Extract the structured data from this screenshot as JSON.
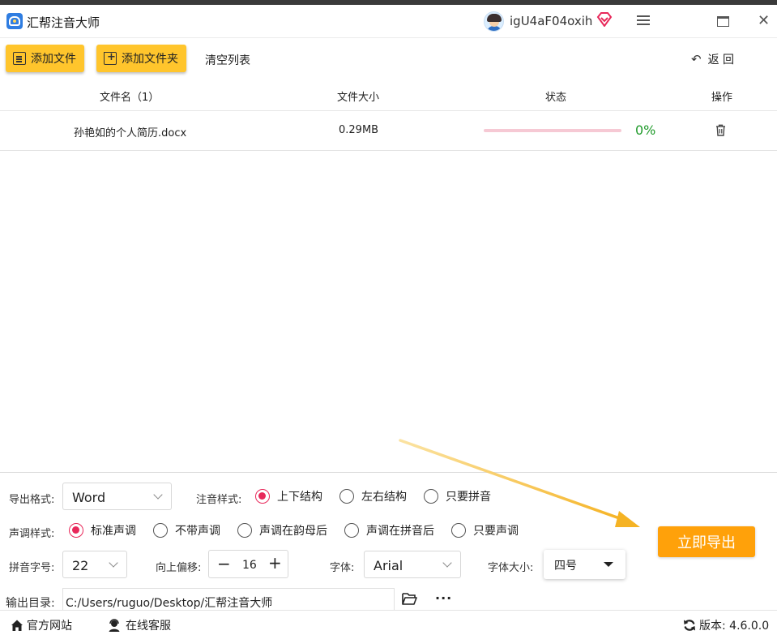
{
  "window": {
    "title": "汇帮注音大师",
    "username": "igU4aF04oxih",
    "icons": [
      "app-logo-icon",
      "avatar",
      "vip-diamond-icon",
      "menu-icon",
      "maximize-icon",
      "close-icon"
    ]
  },
  "toolbar": {
    "add_file_label": "添加文件",
    "add_folder_label": "添加文件夹",
    "clear_list_label": "清空列表",
    "back_label": "返 回"
  },
  "table": {
    "headers": {
      "name": "文件名（1）",
      "size": "文件大小",
      "status": "状态",
      "operation": "操作"
    },
    "rows": [
      {
        "name": "孙艳如的个人简历.docx",
        "size": "0.29MB",
        "progress": 0,
        "percent": "0%"
      }
    ]
  },
  "settings": {
    "export_format": {
      "label": "导出格式:",
      "value": "Word"
    },
    "annotation_style": {
      "label": "注音样式:",
      "options": [
        "上下结构",
        "左右结构",
        "只要拼音"
      ],
      "selected": 0
    },
    "tone_style": {
      "label": "声调样式:",
      "options": [
        "标准声调",
        "不带声调",
        "声调在韵母后",
        "声调在拼音后",
        "只要声调"
      ],
      "selected": 0
    },
    "pinyin_size": {
      "label": "拼音字号:",
      "value": "22"
    },
    "offset": {
      "label": "向上偏移:",
      "value": "16",
      "minus": "−",
      "plus": "+"
    },
    "font": {
      "label": "字体:",
      "value": "Arial"
    },
    "font_size": {
      "label": "字体大小:",
      "value": "四号"
    },
    "output_dir": {
      "label": "输出目录:",
      "value": "C:/Users/ruguo/Desktop/汇帮注音大师",
      "more": "···"
    },
    "export_button": "立即导出"
  },
  "status_bar": {
    "website": "官方网站",
    "service": "在线客服",
    "version": "版本: 4.6.0.0"
  },
  "colors": {
    "accent_yellow": "#ffc52c",
    "export_orange": "#ffa10a",
    "radio_pink": "#e8285a",
    "progress_track": "#f6c9d4",
    "percent_green": "#1f9a2a",
    "arrow_yellow": "#f5b324"
  }
}
